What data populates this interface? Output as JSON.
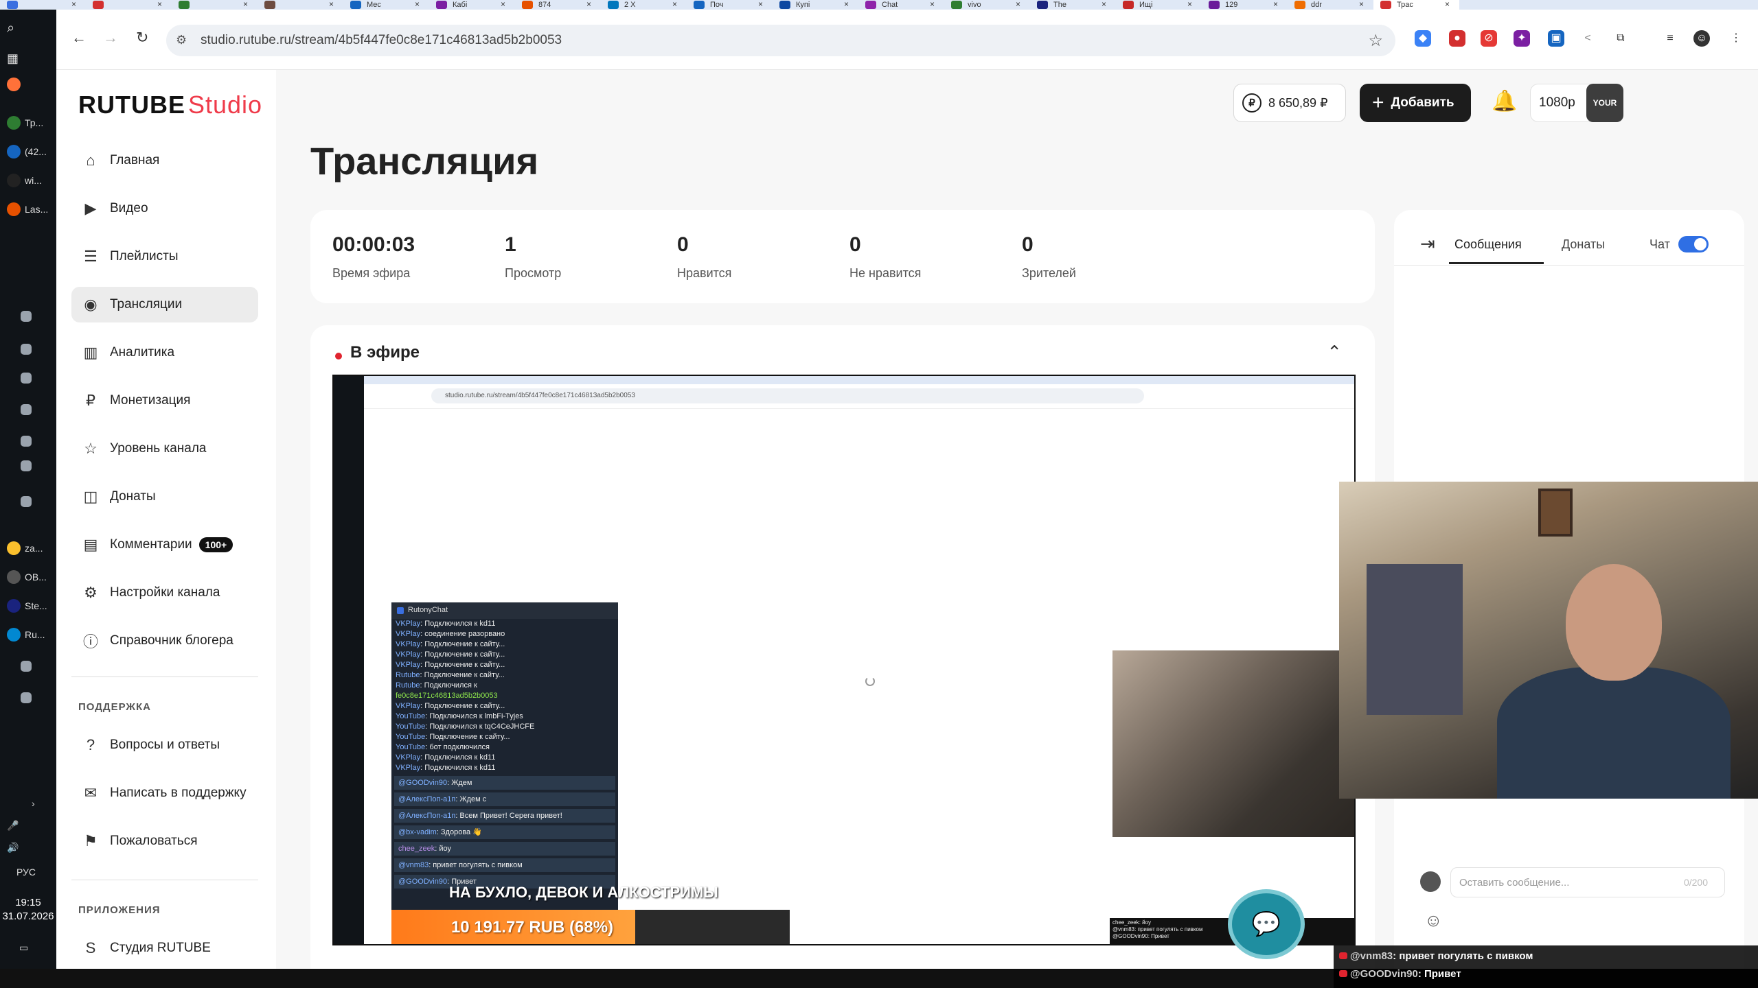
{
  "browser": {
    "tabs": [
      "",
      "",
      "",
      "",
      "Мес",
      "Кабі",
      "874",
      "2 Х",
      "Поч",
      "Купі",
      "Chat",
      "vivo",
      "The",
      "Ищі",
      "129",
      "ddr",
      "Трас"
    ],
    "url": "studio.rutube.ru/stream/4b5f447fe0c8e171c46813ad5b2b0053"
  },
  "os_taskbar": {
    "items": [
      "Тр...",
      "(42...",
      "wi...",
      "Las...",
      "za...",
      "OB...",
      "Ste...",
      "Ru..."
    ],
    "lang": "РУС",
    "time": "19:15",
    "date": "31.07.2026"
  },
  "app": {
    "logo_main": "RUTUBE",
    "logo_studio": "Studio",
    "balance": "8 650,89 ₽",
    "add_label": "Добавить",
    "quality": "1080p",
    "avatar_text": "YOUR"
  },
  "sidebar": {
    "items": [
      {
        "label": "Главная",
        "icon": "⌂"
      },
      {
        "label": "Видео",
        "icon": "▶"
      },
      {
        "label": "Плейлисты",
        "icon": "☰"
      },
      {
        "label": "Трансляции",
        "icon": "◉"
      },
      {
        "label": "Аналитика",
        "icon": "▥"
      },
      {
        "label": "Монетизация",
        "icon": "₽"
      },
      {
        "label": "Уровень канала",
        "icon": "☆"
      },
      {
        "label": "Донаты",
        "icon": "◫"
      },
      {
        "label": "Комментарии",
        "icon": "▤",
        "badge": "100+"
      },
      {
        "label": "Настройки канала",
        "icon": "⚙"
      },
      {
        "label": "Справочник блогера",
        "icon": "ⓘ"
      }
    ],
    "support_header": "ПОДДЕРЖКА",
    "support": [
      {
        "label": "Вопросы и ответы",
        "icon": "?"
      },
      {
        "label": "Написать в поддержку",
        "icon": "✉"
      },
      {
        "label": "Пожаловаться",
        "icon": "⚑"
      }
    ],
    "apps_header": "ПРИЛОЖЕНИЯ",
    "apps": [
      {
        "label": "Студия RUTUBE",
        "icon": "S"
      }
    ]
  },
  "main": {
    "title": "Трансляция",
    "stats": [
      {
        "value": "00:00:03",
        "label": "Время эфира"
      },
      {
        "value": "1",
        "label": "Просмотр"
      },
      {
        "value": "0",
        "label": "Нравится"
      },
      {
        "value": "0",
        "label": "Не нравится"
      },
      {
        "value": "0",
        "label": "Зрителей"
      }
    ],
    "live_title": "В эфире"
  },
  "preview": {
    "url": "studio.rutube.ru/stream/4b5f447fe0c8e171c46813ad5b2b0053",
    "chat_title": "RutonyChat",
    "chat_lines": [
      {
        "src": "VKPlay",
        "text": ": Подключился к kd11"
      },
      {
        "src": "VKPlay",
        "text": ": соединение разорвано"
      },
      {
        "src": "VKPlay",
        "text": ": Подключение к сайту..."
      },
      {
        "src": "VKPlay",
        "text": ": Подключение к сайту..."
      },
      {
        "src": "VKPlay",
        "text": ": Подключение к сайту..."
      },
      {
        "src": "Rutube",
        "text": ": Подключение к сайту..."
      },
      {
        "src": "Rutube",
        "text": ": Подключился к"
      },
      {
        "src": "",
        "text": "fe0c8e171c46813ad5b2b0053"
      },
      {
        "src": "VKPlay",
        "text": ": Подключение к сайту..."
      },
      {
        "src": "YouTube",
        "text": ": Подключился к lmbFi-Tyjes"
      },
      {
        "src": "YouTube",
        "text": ": Подключился к tqC4CeJHCFE"
      },
      {
        "src": "YouTube",
        "text": ": Подключение к сайту..."
      },
      {
        "src": "YouTube",
        "text": ": бот подключился"
      },
      {
        "src": "VKPlay",
        "text": ": Подключился к kd11"
      },
      {
        "src": "VKPlay",
        "text": ": Подключился к kd11"
      }
    ],
    "chat_msgs": [
      {
        "user": "@GOODvin90",
        "text": ": Ждем"
      },
      {
        "user": "@АлексПоп-а1п",
        "text": ": Ждем с"
      },
      {
        "user": "@АлексПоп-а1п",
        "text": ": Всем Привет! Серега привет!"
      },
      {
        "user": "@bx-vadim",
        "text": ": Здорова 👋"
      },
      {
        "user": "chee_zeek",
        "text": ": йоу"
      },
      {
        "user": "@vnm83",
        "text": ": привет погулять с пивком"
      },
      {
        "user": "@GOODvin90",
        "text": ": Привет"
      }
    ],
    "goal_text": "НА БУХЛО, ДЕВОК И АЛКОСТРИМЫ",
    "goal_value": "10 191.77 RUB (68%)",
    "goal_fraction": 0.68,
    "mini_lines": [
      "chee_zeek: йоу",
      "@vnm83: привет погулять с пивком",
      "@GOODvin90: Привет"
    ]
  },
  "chatpanel": {
    "tab_messages": "Сообщения",
    "tab_donates": "Донаты",
    "chat_label": "Чат",
    "placeholder": "Оставить сообщение...",
    "counter": "0/200"
  },
  "overlay_chat": [
    {
      "user": "@vnm83",
      "text": ": привет погулять с пивком"
    },
    {
      "user": "@GOODvin90",
      "text": ": Привет"
    }
  ],
  "colors": {
    "accent": "#ef3b4a",
    "toggle": "#2f6fe4",
    "goal": "#ff8a26"
  }
}
